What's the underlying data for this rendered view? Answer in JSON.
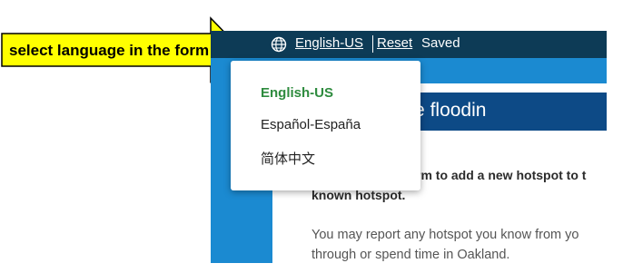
{
  "annotation": {
    "label": "select language in the form",
    "arrow_color": "#ffff00"
  },
  "topbar": {
    "globe_icon": "globe-icon",
    "language_label": "English-US",
    "reset_label": "Reset",
    "saved_label": "Saved",
    "background": "#0d3b56"
  },
  "language_menu": {
    "items": [
      {
        "label": "English-US",
        "selected": true
      },
      {
        "label": "Español-España",
        "selected": false
      },
      {
        "label": "简体中文",
        "selected": false
      }
    ],
    "selected_color": "#2e8b3e"
  },
  "form": {
    "title_fragment": "orm drainage floodin",
    "intro_line1": "rm to add a new hotspot to t",
    "intro_line2": "known hotspot.",
    "body_line1": "You may report any hotspot you know from yo",
    "body_line2": "through or spend time in Oakland.",
    "header_color": "#0d4a86",
    "page_color": "#1b8ad1"
  }
}
